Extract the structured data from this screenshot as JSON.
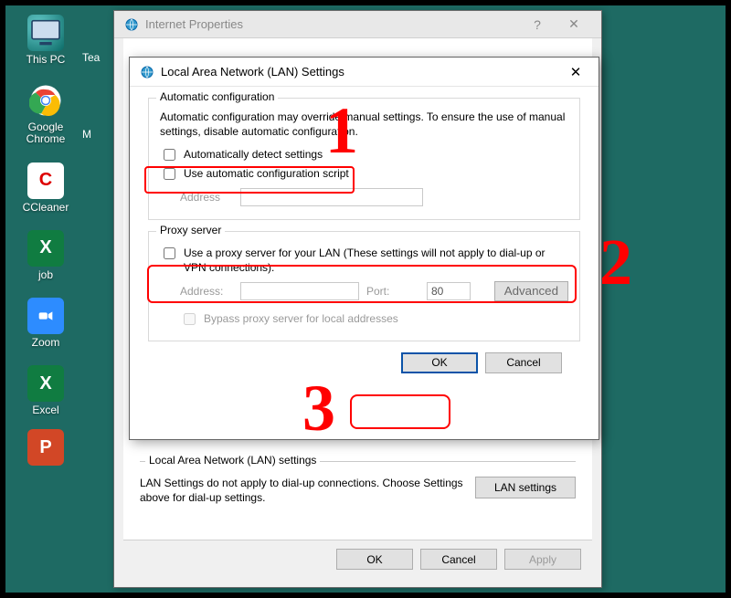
{
  "desktop": {
    "icons": [
      {
        "name": "this-pc",
        "label": "This PC"
      },
      {
        "name": "chrome",
        "label": "Google\nChrome"
      },
      {
        "name": "ccleaner",
        "label": "CCleaner"
      },
      {
        "name": "job",
        "label": "job"
      },
      {
        "name": "zoom",
        "label": "Zoom"
      },
      {
        "name": "excel",
        "label": "Excel"
      },
      {
        "name": "powerpoint",
        "label": ""
      }
    ],
    "partial_labels": {
      "tea": "Tea",
      "m": "M"
    }
  },
  "ip_window": {
    "title": "Internet Properties",
    "help": "?",
    "close": "✕",
    "lan_section": {
      "legend": "Local Area Network (LAN) settings",
      "text": "LAN Settings do not apply to dial-up connections. Choose Settings above for dial-up settings.",
      "button": "LAN settings"
    },
    "footer": {
      "ok": "OK",
      "cancel": "Cancel",
      "apply": "Apply"
    }
  },
  "lan_window": {
    "title": "Local Area Network (LAN) Settings",
    "close": "✕",
    "auto": {
      "legend": "Automatic configuration",
      "desc": "Automatic configuration may override manual settings.  To ensure the use of manual settings, disable automatic configuration.",
      "detect": "Automatically detect settings",
      "script": "Use automatic configuration script",
      "address_label": "Address"
    },
    "proxy": {
      "legend": "Proxy server",
      "use": "Use a proxy server for your LAN (These settings will not apply to dial-up or VPN connections).",
      "address_label": "Address:",
      "port_label": "Port:",
      "port_value": "80",
      "advanced": "Advanced",
      "bypass": "Bypass proxy server for local addresses"
    },
    "footer": {
      "ok": "OK",
      "cancel": "Cancel"
    }
  },
  "annotations": {
    "n1": "1",
    "n2": "2",
    "n3": "3"
  }
}
